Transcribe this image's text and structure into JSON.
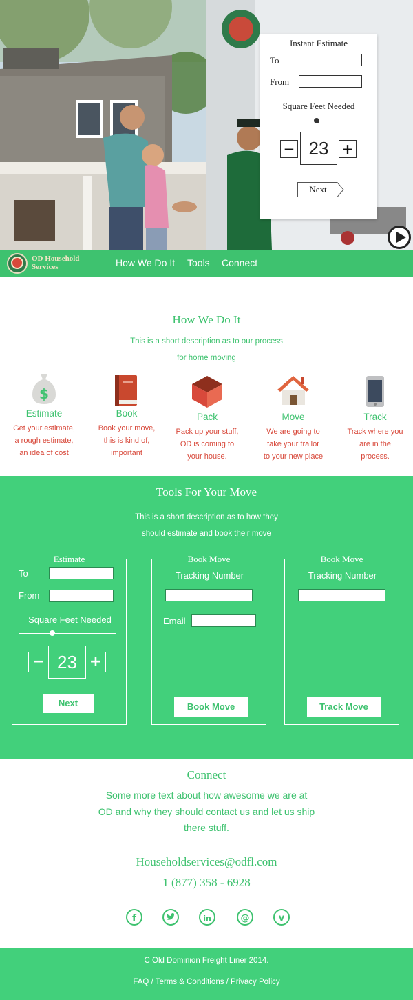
{
  "hero": {
    "estimate_card": {
      "title": "Instant Estimate",
      "to_label": "To",
      "from_label": "From",
      "to_value": "",
      "from_value": "",
      "sqft_label": "Square Feet Needed",
      "sqft_value": "23",
      "slider_fraction": 0.46,
      "next_label": "Next"
    }
  },
  "nav": {
    "logo_line1": "OD Household",
    "logo_line2": "Services",
    "links": [
      "How We Do It",
      "Tools",
      "Connect"
    ]
  },
  "how": {
    "title": "How We Do It",
    "desc_line1": "This is a short description as to our process",
    "desc_line2": "for home moving",
    "steps": [
      {
        "title": "Estimate",
        "lines": [
          "Get your estimate,",
          "a rough estimate,",
          "an idea of cost"
        ],
        "icon": "money-bag-icon"
      },
      {
        "title": "Book",
        "lines": [
          "Book your move,",
          "this is kind of,",
          "important"
        ],
        "icon": "book-icon"
      },
      {
        "title": "Pack",
        "lines": [
          "Pack up your stuff,",
          "OD is coming to",
          "your house."
        ],
        "icon": "box-icon"
      },
      {
        "title": "Move",
        "lines": [
          "We are going to",
          "take your trailor",
          "to your new place"
        ],
        "icon": "house-icon"
      },
      {
        "title": "Track",
        "lines": [
          "Track where you",
          "are in the",
          "process."
        ],
        "icon": "phone-icon"
      }
    ]
  },
  "tools": {
    "title": "Tools For Your Move",
    "desc_line1": "This is a short description as to how they",
    "desc_line2": "should estimate and book their move",
    "estimate_panel": {
      "legend": "Estimate",
      "to_label": "To",
      "from_label": "From",
      "sqft_label": "Square Feet Needed",
      "sqft_value": "23",
      "slider_fraction": 0.34,
      "next_label": "Next"
    },
    "book_panel": {
      "legend": "Book Move",
      "tracking_label": "Tracking Number",
      "email_label": "Email",
      "button_label": "Book Move"
    },
    "track_panel": {
      "legend": "Book Move",
      "tracking_label": "Tracking Number",
      "button_label": "Track Move"
    }
  },
  "connect": {
    "title": "Connect",
    "line1": "Some more text about how awesome we are at",
    "line2": "OD and why they should contact us and let us ship",
    "line3": "there stuff.",
    "email": "Householdservices@odfl.com",
    "phone": "1 (877) 358 - 6928",
    "social_icons": [
      "facebook-icon",
      "twitter-icon",
      "linkedin-icon",
      "email-at-icon",
      "vimeo-icon"
    ]
  },
  "footer": {
    "copyright": "C Old Dominion Freight Liner 2014.",
    "links": "FAQ / Terms & Conditions / Privacy Policy"
  },
  "colors": {
    "brand_green": "#3ec26f",
    "accent_red": "#d8493b",
    "panel_green": "#42d07b"
  }
}
